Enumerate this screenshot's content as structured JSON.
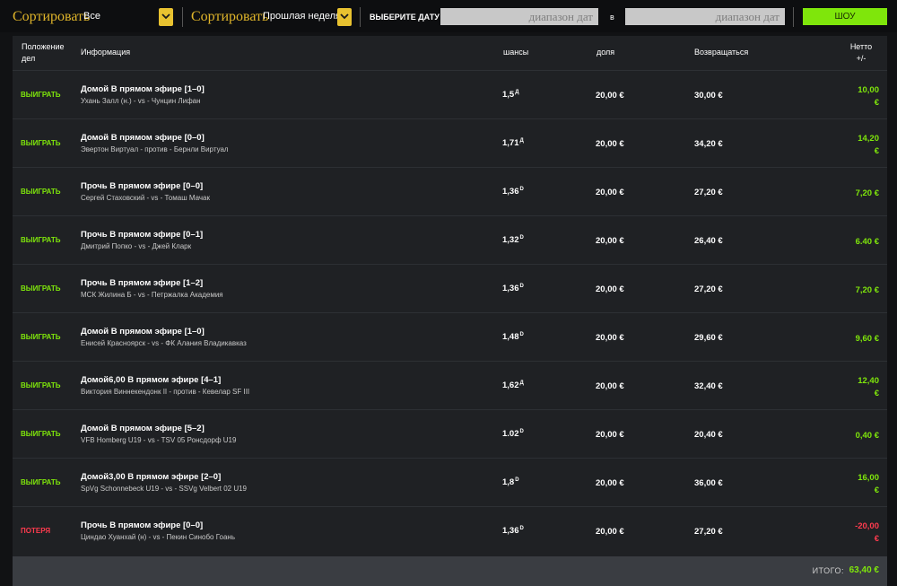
{
  "colors": {
    "win": "#7fe60b",
    "loss": "#ff3b4e",
    "accent": "#e8c230",
    "show": "#7fe60b"
  },
  "filters": {
    "sort1_label": "Сортировать",
    "sort1_value": "Все",
    "sort2_label": "Сортировать",
    "sort2_value": "Прошлая неделя",
    "date_label": "ВЫБЕРИТЕ ДАТУ",
    "from_placeholder": "диапазон дат",
    "in_label": "в",
    "to_placeholder": "диапазон дат",
    "show_button": "ШОУ"
  },
  "icons": {
    "dropdown": "chevron-down-icon"
  },
  "table": {
    "headers": {
      "position_line1": "Положение",
      "position_line2": "дел",
      "info": "Информация",
      "odds": "шансы",
      "stake": "доля",
      "return": "Возвращаться",
      "net_line1": "Нетто",
      "net_line2": "+/-"
    },
    "rows": [
      {
        "result": "ВЫИГРАТЬ",
        "status": "win",
        "title": "Домой В прямом эфире [1–0]",
        "teams": "Ухань Залл (н.) - vs - Чунцин Лифан",
        "odds": "1,5",
        "odds_sup": "Д",
        "stake": "20,00 €",
        "return": "30,00 €",
        "net_amount": "10,00",
        "net_currency": "€"
      },
      {
        "result": "ВЫИГРАТЬ",
        "status": "win",
        "title": "Домой В прямом эфире [0–0]",
        "teams": "Эвертон Виртуал - против - Бернли Виртуал",
        "odds": "1,71",
        "odds_sup": "Д",
        "stake": "20,00 €",
        "return": "34,20 €",
        "net_amount": "14,20",
        "net_currency": "€"
      },
      {
        "result": "ВЫИГРАТЬ",
        "status": "win",
        "title": "Прочь В прямом эфире [0–0]",
        "teams": "Сергей Стаховский - vs - Томаш Мачак",
        "odds": "1,36",
        "odds_sup": "D",
        "stake": "20,00 €",
        "return": "27,20 €",
        "net_amount": "7,20 €",
        "net_currency": ""
      },
      {
        "result": "ВЫИГРАТЬ",
        "status": "win",
        "title": "Прочь В прямом эфире [0–1]",
        "teams": "Дмитрий Попко - vs - Джей Кларк",
        "odds": "1,32",
        "odds_sup": "D",
        "stake": "20,00 €",
        "return": "26,40 €",
        "net_amount": "6.40 €",
        "net_currency": ""
      },
      {
        "result": "ВЫИГРАТЬ",
        "status": "win",
        "title": "Прочь В прямом эфире [1–2]",
        "teams": "МСК Жилина Б - vs - Петржалка Академия",
        "odds": "1,36",
        "odds_sup": "D",
        "stake": "20,00 €",
        "return": "27,20 €",
        "net_amount": "7,20 €",
        "net_currency": ""
      },
      {
        "result": "ВЫИГРАТЬ",
        "status": "win",
        "title": "Домой В прямом эфире [1–0]",
        "teams": "Енисей Красноярск - vs - ФК Алания Владикавказ",
        "odds": "1,48",
        "odds_sup": "D",
        "stake": "20,00 €",
        "return": "29,60 €",
        "net_amount": "9,60 €",
        "net_currency": ""
      },
      {
        "result": "ВЫИГРАТЬ",
        "status": "win",
        "title": "Домой6,00 В прямом эфире [4–1]",
        "teams": "Виктория Виннекендонк II - против - Кевелар SF III",
        "odds": "1,62",
        "odds_sup": "Д",
        "stake": "20,00 €",
        "return": "32,40 €",
        "net_amount": "12,40",
        "net_currency": "€"
      },
      {
        "result": "ВЫИГРАТЬ",
        "status": "win",
        "title": "Домой В прямом эфире [5–2]",
        "teams": "VFB Homberg U19 - vs - TSV 05 Ронсдорф U19",
        "odds": "1.02",
        "odds_sup": "D",
        "stake": "20,00 €",
        "return": "20,40 €",
        "net_amount": "0,40 €",
        "net_currency": ""
      },
      {
        "result": "ВЫИГРАТЬ",
        "status": "win",
        "title": "Домой3,00 В прямом эфире [2–0]",
        "teams": "SpVg Schonnebeck U19 - vs - SSVg Velbert 02 U19",
        "odds": "1,8",
        "odds_sup": "D",
        "stake": "20,00 €",
        "return": "36,00 €",
        "net_amount": "16,00",
        "net_currency": "€"
      },
      {
        "result": "ПОТЕРЯ",
        "status": "loss",
        "title": "Прочь В прямом эфире [0–0]",
        "teams": "Циндао Хуанхай (н) - vs - Пекин Синобо Гоань",
        "odds": "1,36",
        "odds_sup": "D",
        "stake": "20,00 €",
        "return": "27,20 €",
        "net_amount": "-20,00",
        "net_currency": "€"
      }
    ],
    "total_label": "ИТОГО:",
    "total_value": "63,40 €"
  }
}
